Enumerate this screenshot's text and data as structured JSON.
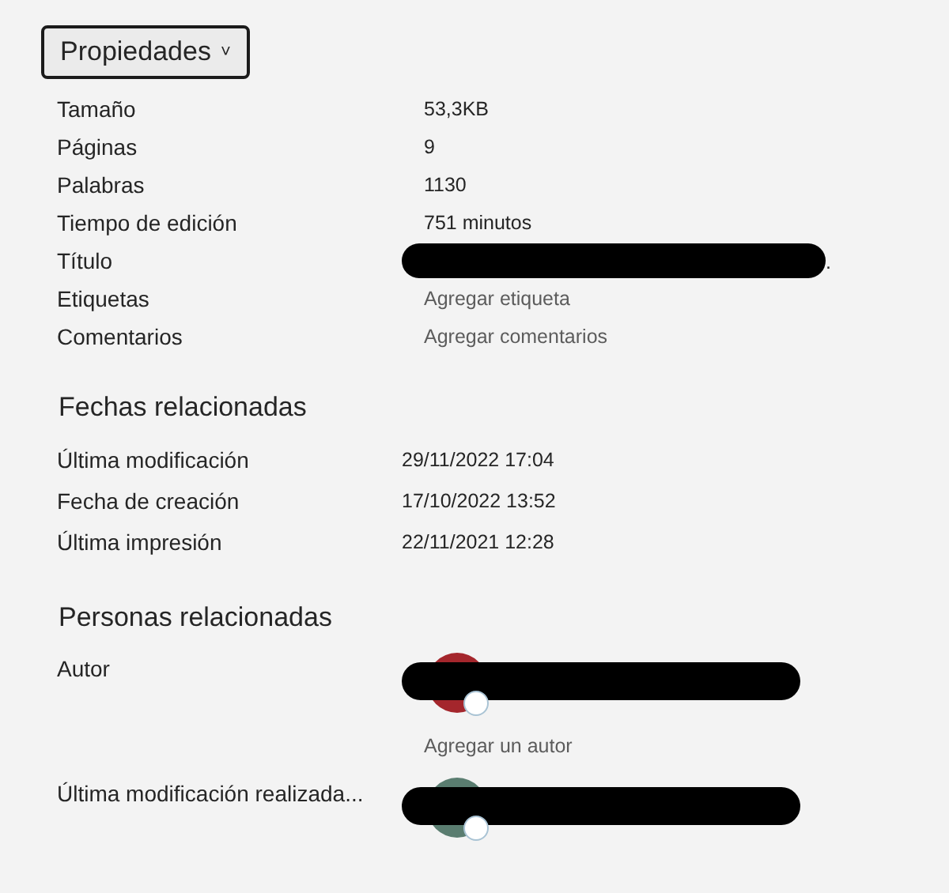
{
  "header_button": {
    "label": "Propiedades",
    "expanded": true,
    "caret": "˅"
  },
  "properties": [
    {
      "label": "Tamaño",
      "value": "53,3KB",
      "kind": "text"
    },
    {
      "label": "Páginas",
      "value": "9",
      "kind": "text"
    },
    {
      "label": "Palabras",
      "value": "1130",
      "kind": "text"
    },
    {
      "label": "Tiempo de edición",
      "value": "751 minutos",
      "kind": "text"
    },
    {
      "label": "Título",
      "value": ".",
      "kind": "redacted"
    },
    {
      "label": "Etiquetas",
      "value": "Agregar etiqueta",
      "kind": "action"
    },
    {
      "label": "Comentarios",
      "value": "Agregar comentarios",
      "kind": "action"
    }
  ],
  "related_dates": {
    "title": "Fechas relacionadas",
    "rows": [
      {
        "label": "Última modificación",
        "value": "29/11/2022 17:04"
      },
      {
        "label": "Fecha de creación",
        "value": "17/10/2022 13:52"
      },
      {
        "label": "Última impresión",
        "value": "22/11/2021 12:28"
      }
    ]
  },
  "related_people": {
    "title": "Personas relacionadas",
    "people": [
      {
        "label": "Autor",
        "color": "#a4262c",
        "action": "Agregar un autor"
      },
      {
        "label": "Última modificación realizada...",
        "color": "#5a7d70"
      }
    ]
  }
}
